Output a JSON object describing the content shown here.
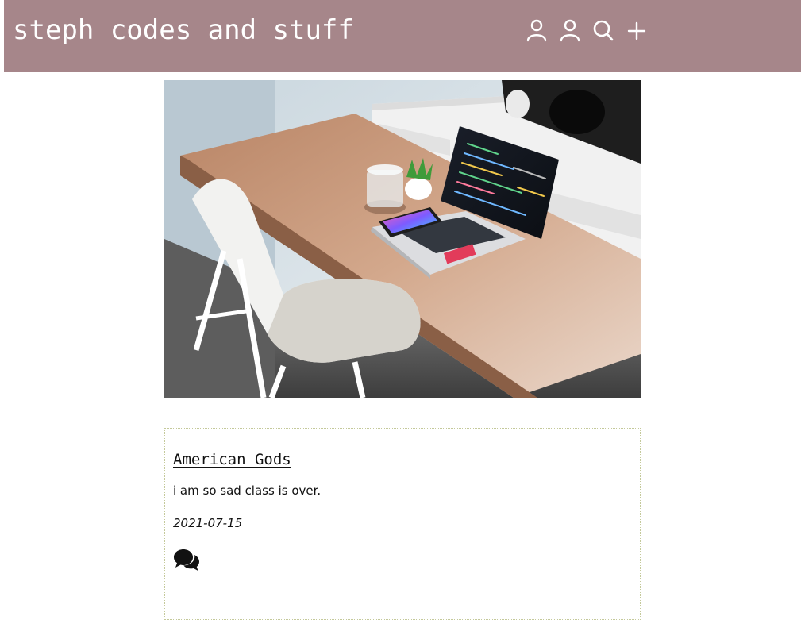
{
  "header": {
    "site_title": "steph codes and stuff",
    "icons": [
      "user-icon",
      "user-icon",
      "search-icon",
      "plus-icon"
    ]
  },
  "hero": {
    "image_description_icon": "workspace-photo"
  },
  "post": {
    "title": "American Gods",
    "excerpt": "i am so sad class is over.",
    "date": "2021-07-15",
    "comments_icon": "comments-icon"
  },
  "colors": {
    "header_bg": "#a6868a",
    "header_text": "#ffffff",
    "card_border": "#c4c99a"
  }
}
